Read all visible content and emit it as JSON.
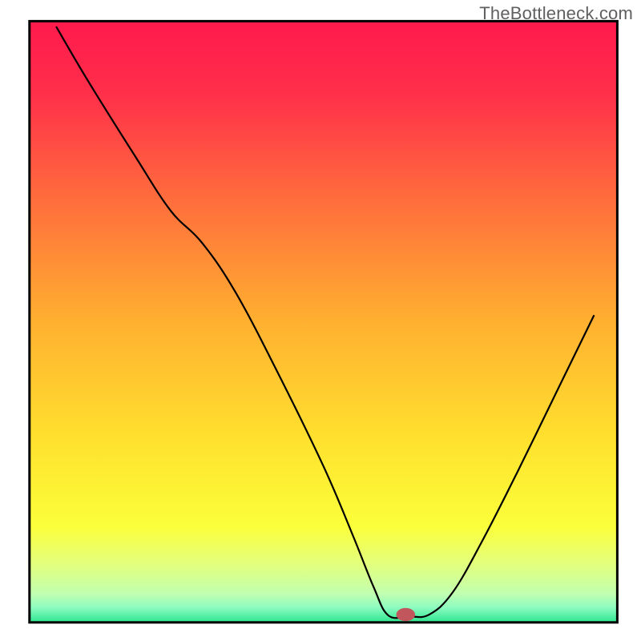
{
  "watermark": "TheBottleneck.com",
  "chart_data": {
    "type": "line",
    "title": "",
    "xlabel": "",
    "ylabel": "",
    "xlim": [
      0,
      100
    ],
    "ylim": [
      0,
      100
    ],
    "note": "Axes have no visible tick labels; values are estimated percentages of frame dimension.",
    "background_gradient": {
      "stops": [
        {
          "pos": 0.0,
          "color": "#ff1a4d"
        },
        {
          "pos": 0.12,
          "color": "#ff2f4a"
        },
        {
          "pos": 0.3,
          "color": "#ff6e3c"
        },
        {
          "pos": 0.5,
          "color": "#ffb030"
        },
        {
          "pos": 0.7,
          "color": "#ffe22e"
        },
        {
          "pos": 0.84,
          "color": "#fbff3a"
        },
        {
          "pos": 0.9,
          "color": "#e4ff7a"
        },
        {
          "pos": 0.952,
          "color": "#c2ffb0"
        },
        {
          "pos": 0.975,
          "color": "#8dfcc0"
        },
        {
          "pos": 1.0,
          "color": "#2de58f"
        }
      ]
    },
    "series": [
      {
        "name": "bottleneck-curve",
        "x": [
          4.6,
          10.0,
          18.0,
          24.0,
          29.3,
          35.0,
          42.0,
          50.0,
          55.0,
          58.5,
          61.0,
          64.5,
          68.0,
          72.0,
          77.0,
          83.0,
          90.0,
          96.0
        ],
        "y": [
          99.0,
          90.0,
          77.5,
          68.5,
          63.2,
          55.0,
          42.0,
          26.0,
          14.5,
          6.0,
          1.2,
          1.0,
          1.3,
          5.0,
          13.5,
          25.0,
          39.0,
          51.0
        ]
      }
    ],
    "marker": {
      "name": "min-point-marker",
      "x": 64.0,
      "y": 1.3,
      "color": "#c1575c",
      "rx_pct": 1.6,
      "ry_pct": 1.1
    },
    "frame": {
      "left_pct": 4.6,
      "right_pct": 96.3,
      "top_pct": 3.3,
      "bottom_pct": 97.1,
      "stroke": "#000000",
      "stroke_width": 3.0
    }
  }
}
